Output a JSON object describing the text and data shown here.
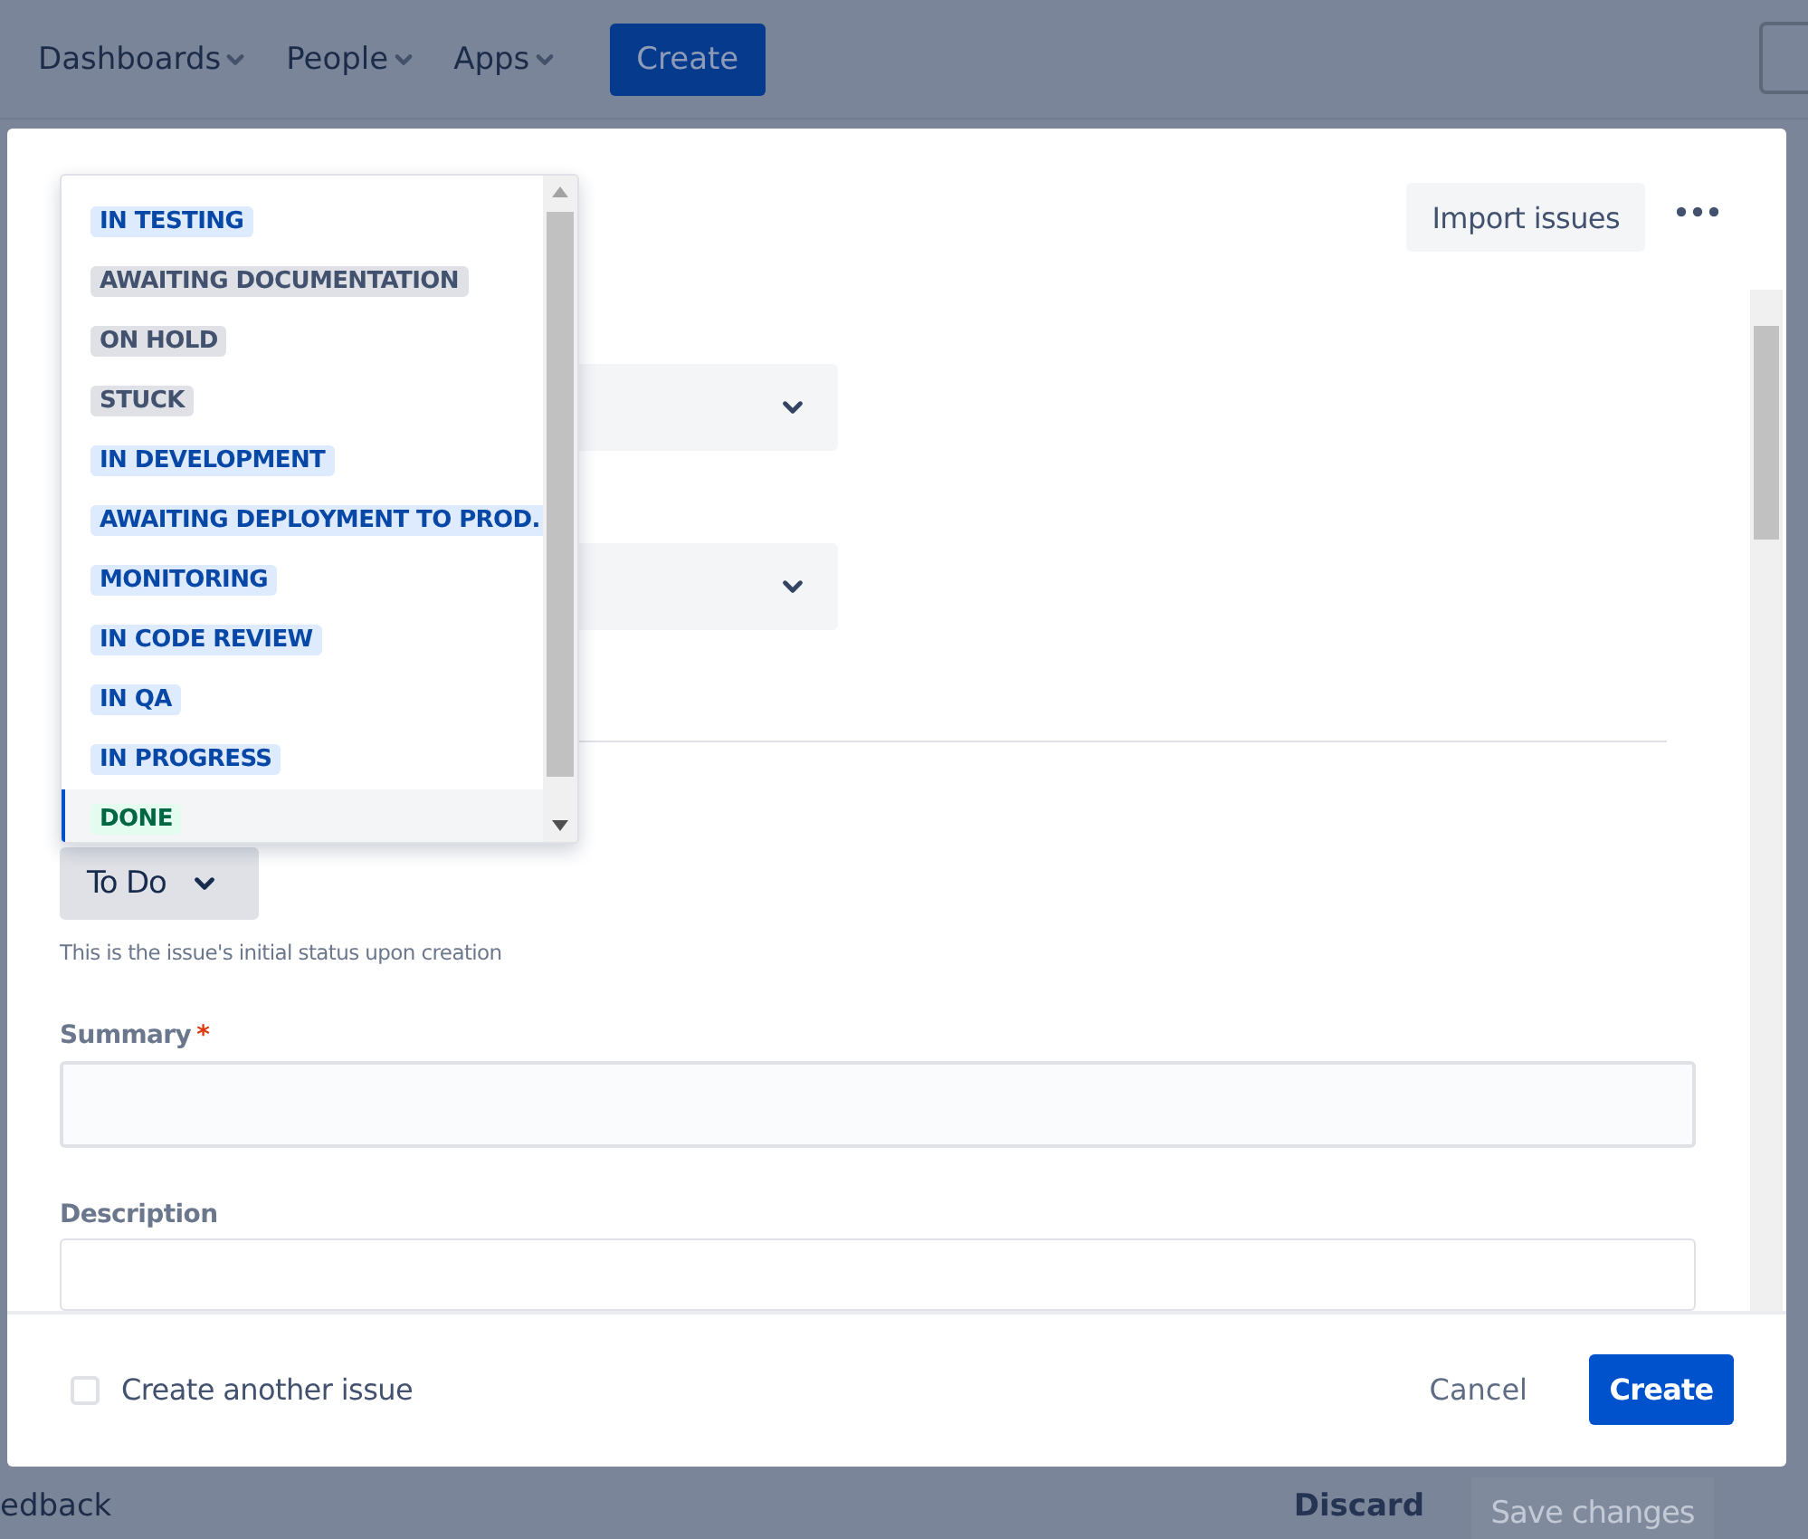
{
  "nav": {
    "items": [
      {
        "label": "Dashboards"
      },
      {
        "label": "People"
      },
      {
        "label": "Apps"
      }
    ],
    "create": "Create"
  },
  "modal": {
    "import_button": "Import issues",
    "status_dropdown": {
      "options": [
        {
          "label": "IN TESTING",
          "kind": "progress",
          "selected": false
        },
        {
          "label": "AWAITING DOCUMENTATION",
          "kind": "todo",
          "selected": false
        },
        {
          "label": "ON HOLD",
          "kind": "todo",
          "selected": false
        },
        {
          "label": "STUCK",
          "kind": "todo",
          "selected": false
        },
        {
          "label": "IN DEVELOPMENT",
          "kind": "progress",
          "selected": false
        },
        {
          "label": "AWAITING DEPLOYMENT TO PROD.",
          "kind": "progress",
          "selected": false
        },
        {
          "label": "MONITORING",
          "kind": "progress",
          "selected": false
        },
        {
          "label": "IN CODE REVIEW",
          "kind": "progress",
          "selected": false
        },
        {
          "label": "IN QA",
          "kind": "progress",
          "selected": false
        },
        {
          "label": "IN PROGRESS",
          "kind": "progress",
          "selected": false
        },
        {
          "label": "DONE",
          "kind": "done",
          "selected": true
        }
      ]
    },
    "status_button": "To Do",
    "status_help": "This is the issue's initial status upon creation",
    "summary_label": "Summary",
    "summary_required": "*",
    "description_label": "Description",
    "create_another": {
      "label": "Create another issue",
      "checked": false
    },
    "cancel": "Cancel",
    "create": "Create"
  },
  "background_footer": {
    "feedback": "edback",
    "discard": "Discard",
    "save": "Save changes"
  }
}
